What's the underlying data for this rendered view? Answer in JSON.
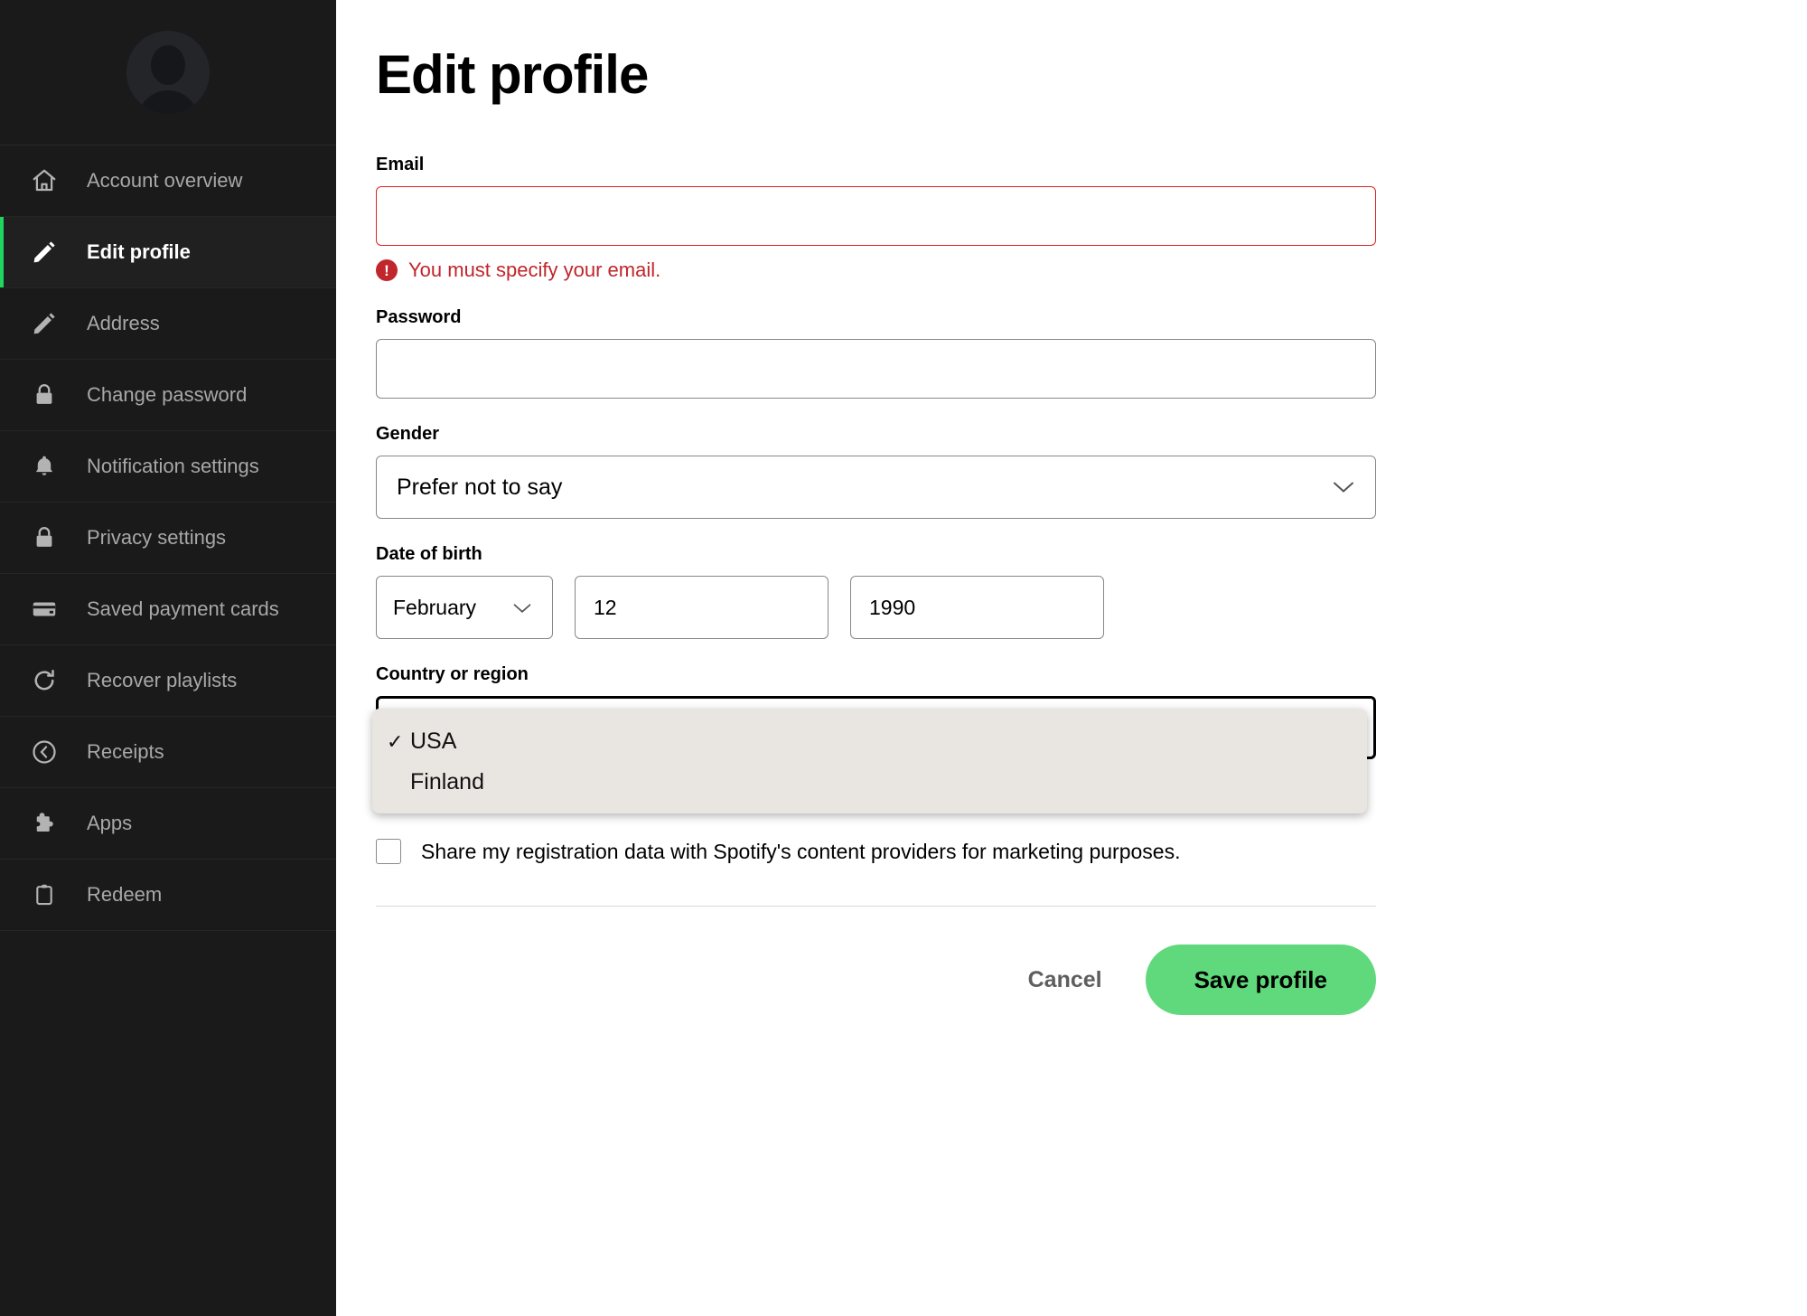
{
  "sidebar": {
    "avatar_name": "default-user-avatar",
    "items": [
      {
        "label": "Account overview",
        "icon": "home-icon",
        "active": false
      },
      {
        "label": "Edit profile",
        "icon": "pencil-icon",
        "active": true
      },
      {
        "label": "Address",
        "icon": "pencil-icon",
        "active": false
      },
      {
        "label": "Change password",
        "icon": "lock-icon",
        "active": false
      },
      {
        "label": "Notification settings",
        "icon": "bell-icon",
        "active": false
      },
      {
        "label": "Privacy settings",
        "icon": "lock-icon",
        "active": false
      },
      {
        "label": "Saved payment cards",
        "icon": "credit-card-icon",
        "active": false
      },
      {
        "label": "Recover playlists",
        "icon": "refresh-icon",
        "active": false
      },
      {
        "label": "Receipts",
        "icon": "clock-back-icon",
        "active": false
      },
      {
        "label": "Apps",
        "icon": "puzzle-piece-icon",
        "active": false
      },
      {
        "label": "Redeem",
        "icon": "clipboard-icon",
        "active": false
      }
    ]
  },
  "main": {
    "title": "Edit profile",
    "email": {
      "label": "Email",
      "value": "",
      "placeholder": "",
      "error": "You must specify your email.",
      "error_icon": "!"
    },
    "password": {
      "label": "Password",
      "value": "",
      "placeholder": ""
    },
    "gender": {
      "label": "Gender",
      "value": "Prefer not to say"
    },
    "dob": {
      "label": "Date of birth",
      "month": "February",
      "day": "12",
      "year": "1990"
    },
    "country": {
      "label": "Country or region",
      "value": "USA",
      "options": [
        {
          "label": "USA",
          "selected": true
        },
        {
          "label": "Finland",
          "selected": false
        }
      ],
      "check_glyph": "✓"
    },
    "marketing": {
      "label": "Share my registration data with Spotify's content providers for marketing purposes.",
      "checked": false
    },
    "footer": {
      "cancel_label": "Cancel",
      "save_label": "Save profile"
    }
  },
  "colors": {
    "accent_green": "#1ed760",
    "save_button": "#5fd97c",
    "error_red": "#c0262b",
    "sidebar_bg": "#1a1a1a",
    "dropdown_bg": "#e9e5e1"
  }
}
